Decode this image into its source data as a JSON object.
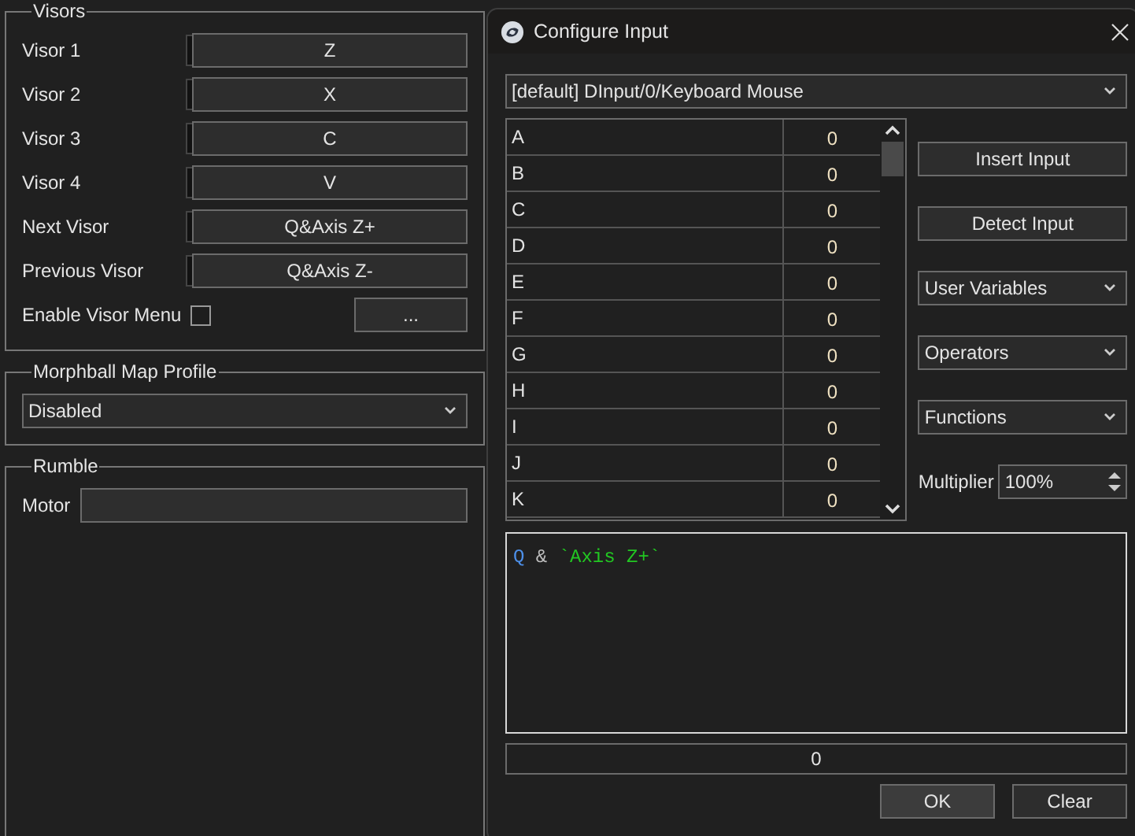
{
  "visors": {
    "title": "Visors",
    "bindings": [
      {
        "label": "Visor 1",
        "value": "Z"
      },
      {
        "label": "Visor 2",
        "value": "X"
      },
      {
        "label": "Visor 3",
        "value": "C"
      },
      {
        "label": "Visor 4",
        "value": "V"
      },
      {
        "label": "Next Visor",
        "value": "Q&Axis Z+"
      },
      {
        "label": "Previous Visor",
        "value": "Q&Axis Z-"
      }
    ],
    "enable_menu": {
      "label": "Enable Visor Menu",
      "checked": false
    },
    "more_button": "..."
  },
  "morphball": {
    "title": "Morphball  Map Profile",
    "profile": "Disabled"
  },
  "rumble": {
    "title": "Rumble",
    "motor": {
      "label": "Motor"
    }
  },
  "dialog": {
    "title": "Configure Input",
    "device": "[default] DInput/0/Keyboard Mouse",
    "inputs": [
      {
        "name": "A",
        "value": "0"
      },
      {
        "name": "B",
        "value": "0"
      },
      {
        "name": "C",
        "value": "0"
      },
      {
        "name": "D",
        "value": "0"
      },
      {
        "name": "E",
        "value": "0"
      },
      {
        "name": "F",
        "value": "0"
      },
      {
        "name": "G",
        "value": "0"
      },
      {
        "name": "H",
        "value": "0"
      },
      {
        "name": "I",
        "value": "0"
      },
      {
        "name": "J",
        "value": "0"
      },
      {
        "name": "K",
        "value": "0"
      }
    ],
    "buttons": [
      "Insert Input",
      "Detect Input"
    ],
    "menus": [
      "User Variables",
      "Operators",
      "Functions"
    ],
    "multiplier": {
      "label": "Multiplier",
      "value": "100%"
    },
    "expression": [
      {
        "kind": "input",
        "text": "Q"
      },
      {
        "kind": "operator",
        "text": "&"
      },
      {
        "kind": "literal",
        "text": "`Axis Z+`"
      }
    ],
    "result": "0",
    "actions": [
      "OK",
      "Clear"
    ]
  }
}
